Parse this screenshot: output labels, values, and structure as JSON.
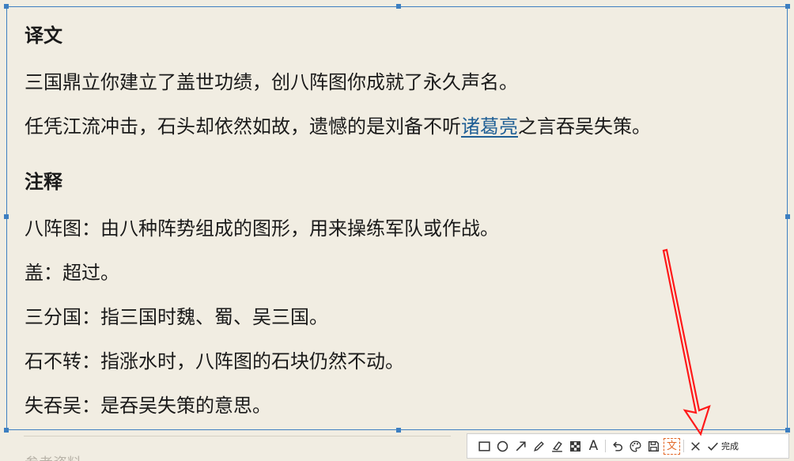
{
  "translation": {
    "heading": "译文",
    "line1": "三国鼎立你建立了盖世功绩，创八阵图你成就了永久声名。",
    "line2_before": "任凭江流冲击，石头却依然如故，遗憾的是刘备不听",
    "line2_link": "诸葛亮",
    "line2_after": "之言吞吴失策。"
  },
  "notes": {
    "heading": "注释",
    "items": [
      "八阵图：由八种阵势组成的图形，用来操练军队或作战。",
      "盖：超过。",
      "三分国：指三国时魏、蜀、吴三国。",
      "石不转：指涨水时，八阵图的石块仍然不动。",
      "失吞吴：是吞吴失策的意思。"
    ]
  },
  "below_text": "参考资料",
  "toolbar": {
    "tools": [
      "rectangle-icon",
      "ellipse-icon",
      "arrow-icon",
      "pen-icon",
      "marker-icon",
      "mosaic-icon",
      "text-icon",
      "undo-icon",
      "palette-icon",
      "save-icon",
      "ocr-icon",
      "close-icon"
    ],
    "ocr_glyph": "文",
    "text_glyph": "A",
    "done_label": "完成"
  },
  "colors": {
    "selection": "#3d7fc1",
    "annotation_arrow": "#ff0000",
    "active_tool": "#e36a2a",
    "link": "#1f5f95"
  }
}
